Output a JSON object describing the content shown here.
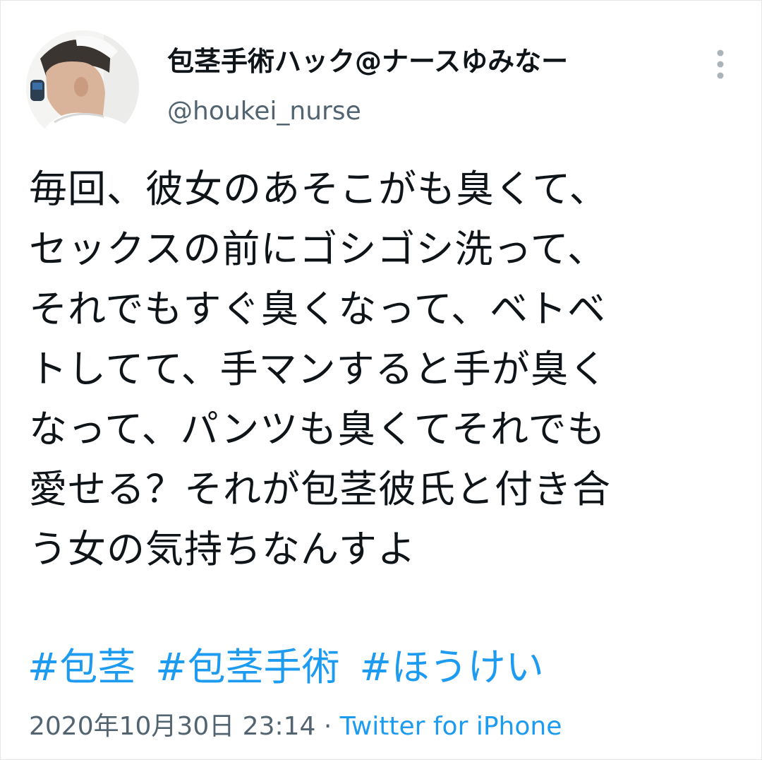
{
  "author": {
    "display_name": "包茎手術ハック@ナースゆみなー",
    "handle": "@houkei_nurse"
  },
  "tweet": {
    "text": "毎回、彼女のあそこがも臭くて、\nセックスの前にゴシゴシ洗って、\nそれでもすぐ臭くなって、ベトベ\nトしてて、手マンすると手が臭く\nなって、パンツも臭くてそれでも\n愛せる？それが包茎彼氏と付き合\nう女の気持ちなんすよ",
    "hashtags": [
      "#包茎",
      "#包茎手術",
      "#ほうけい"
    ],
    "timestamp": "2020年10月30日 23:14",
    "separator": " · ",
    "source": "Twitter for iPhone"
  },
  "icons": {
    "avatar": "profile-photo",
    "more": "more-vertical-icon"
  },
  "colors": {
    "link": "#1d9bf0",
    "secondary_text": "#536471",
    "primary_text": "#0f1419"
  }
}
